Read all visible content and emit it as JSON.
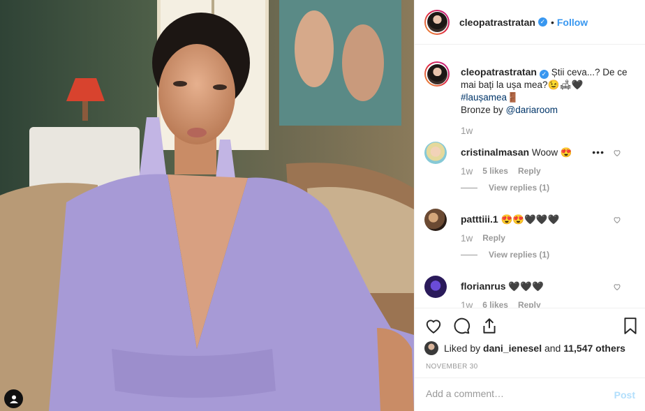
{
  "post_owner": {
    "username": "cleopatrastratan",
    "verified_icon": "verified-badge-icon",
    "follow_label": "Follow",
    "separator": "•"
  },
  "caption": {
    "username": "cleopatrastratan",
    "text": "Știi ceva...? De ce mai bați la ușa mea?😉🛋🖤",
    "hashtag": "#laușamea🚪",
    "credit_prefix": "Bronze by",
    "credit_mention": "@dariaroom",
    "time": "1w"
  },
  "comments": [
    {
      "username": "cristinalmasan",
      "text": "Woow 😍",
      "time": "1w",
      "likes": "5 likes",
      "reply": "Reply",
      "view_replies": "View replies (1)",
      "more": "•••"
    },
    {
      "username": "patttiii.1",
      "text": "😍😍🖤🖤🖤",
      "time": "1w",
      "reply": "Reply",
      "view_replies": "View replies (1)"
    },
    {
      "username": "florianrus",
      "text": "🖤🖤🖤",
      "time": "1w",
      "likes": "6 likes",
      "reply": "Reply"
    }
  ],
  "likes": {
    "prefix": "Liked by",
    "user": "dani_ienesel",
    "connector": "and",
    "count": "11,547 others"
  },
  "date": "NOVEMBER 30",
  "add_comment": {
    "placeholder": "Add a comment…",
    "post_label": "Post"
  },
  "colors": {
    "accent": "#3897f0",
    "dress": "#a79ad6",
    "post_disabled": "#b2dffc"
  }
}
